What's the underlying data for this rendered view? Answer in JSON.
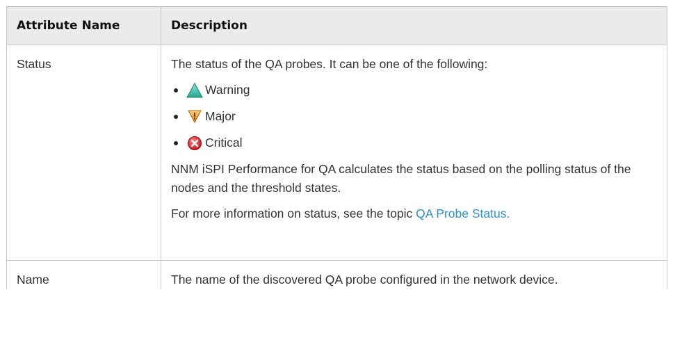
{
  "table": {
    "headers": [
      "Attribute Name",
      "Description"
    ],
    "rows": [
      {
        "name": "Status",
        "intro": "The status of the QA probes. It can be one of the following:",
        "statuses": [
          {
            "label": "Warning",
            "icon": "warning-triangle-icon",
            "color": "#3cbfa8"
          },
          {
            "label": "Major",
            "icon": "major-down-triangle-icon",
            "color": "#f0a830"
          },
          {
            "label": "Critical",
            "icon": "critical-x-circle-icon",
            "color": "#e8282c"
          }
        ],
        "note": "NNM iSPI Performance for QA calculates the status based on the polling status of the nodes and the threshold states.",
        "more_info_prefix": "For more information on status, see the topic ",
        "more_info_link": "QA Probe Status."
      },
      {
        "name": "Name",
        "description": "The name of the discovered QA probe configured in the network device."
      }
    ]
  },
  "colors": {
    "header_bg": "#ebebeb",
    "border": "#c8c8c8",
    "link": "#2d8ed0",
    "text": "#333333"
  }
}
